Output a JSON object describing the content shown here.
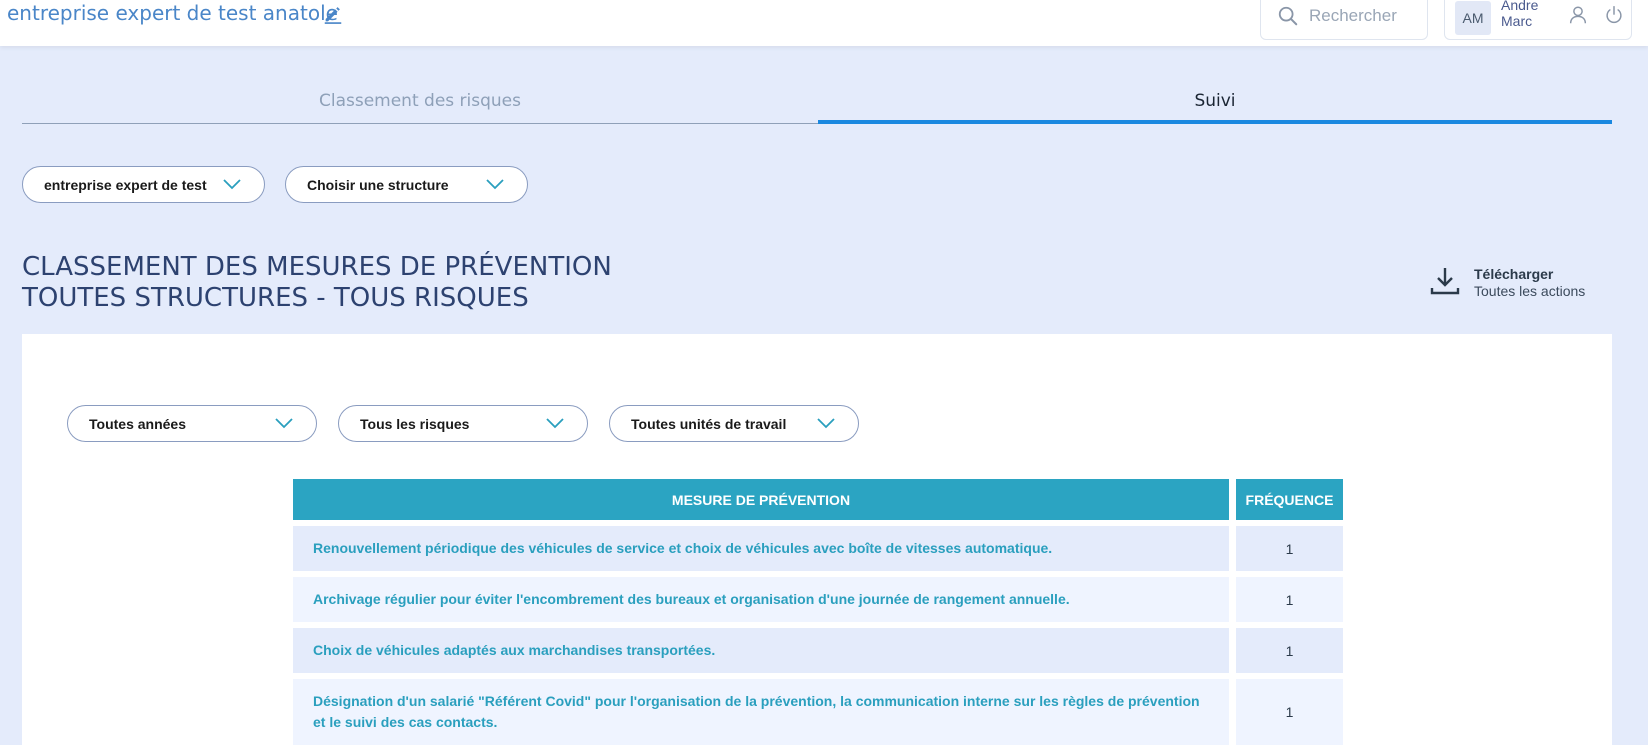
{
  "header": {
    "company_title": "entreprise expert de test anatole",
    "search_placeholder": "Rechercher",
    "avatar_initials": "AM",
    "user_first_name": "Andre",
    "user_last_name": "Marc"
  },
  "tabs": [
    {
      "label": "Classement des risques",
      "active": false
    },
    {
      "label": "Suivi",
      "active": true
    }
  ],
  "filters_top": {
    "company_select": "entreprise expert de test",
    "structure_select": "Choisir une structure"
  },
  "heading": {
    "line1": "CLASSEMENT DES MESURES DE PRÉVENTION",
    "line2": "TOUTES STRUCTURES - TOUS RISQUES"
  },
  "download": {
    "title": "Télécharger",
    "subtitle": "Toutes les actions"
  },
  "filters_card": {
    "years_select": "Toutes années",
    "risks_select": "Tous les risques",
    "units_select": "Toutes unités de travail"
  },
  "table": {
    "columns": [
      "MESURE DE PRÉVENTION",
      "FRÉQUENCE"
    ],
    "rows": [
      {
        "mesure": "Renouvellement périodique des véhicules de service et choix de véhicules avec boîte de vitesses automatique.",
        "frequence": "1"
      },
      {
        "mesure": "Archivage régulier pour éviter l'encombrement des bureaux et organisation d'une journée de rangement annuelle.",
        "frequence": "1"
      },
      {
        "mesure": "Choix de véhicules adaptés aux marchandises transportées.",
        "frequence": "1"
      },
      {
        "mesure": "Désignation d'un salarié \"Référent Covid\" pour l'organisation de la prévention, la communication interne sur les règles de prévention et le suivi des cas contacts.",
        "frequence": "1"
      }
    ]
  },
  "colors": {
    "accent": "#1a88e0",
    "table_header": "#2ba4c2",
    "link_text": "#2a9fbe",
    "background": "#e4ebfb"
  }
}
